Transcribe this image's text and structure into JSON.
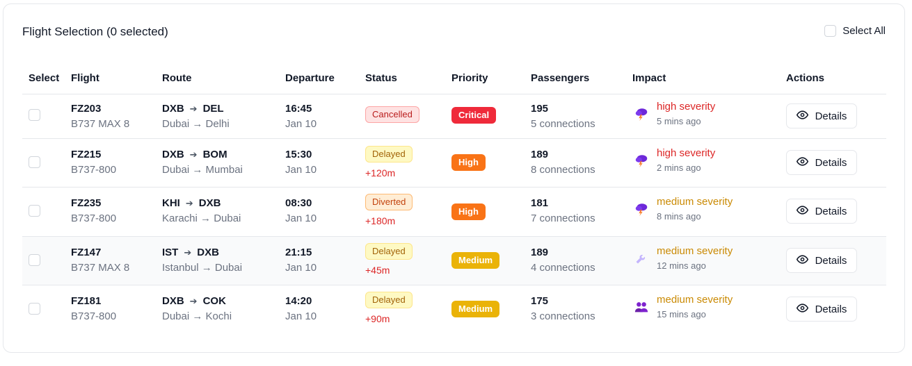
{
  "header": {
    "title": "Flight Selection (0 selected)",
    "select_all_label": "Select All"
  },
  "columns": [
    "Select",
    "Flight",
    "Route",
    "Departure",
    "Status",
    "Priority",
    "Passengers",
    "Impact",
    "Actions"
  ],
  "details_label": "Details",
  "rows": [
    {
      "flight": "FZ203",
      "aircraft": "B737 MAX 8",
      "from": "DXB",
      "to": "DEL",
      "route_text": "Dubai → Delhi",
      "time": "16:45",
      "date": "Jan 10",
      "status": "Cancelled",
      "delay": "",
      "priority": "Critical",
      "passengers": "195",
      "connections": "5 connections",
      "impact_icon": "storm-icon",
      "severity": "high severity",
      "ago": "5 mins ago"
    },
    {
      "flight": "FZ215",
      "aircraft": "B737-800",
      "from": "DXB",
      "to": "BOM",
      "route_text": "Dubai → Mumbai",
      "time": "15:30",
      "date": "Jan 10",
      "status": "Delayed",
      "delay": "+120m",
      "priority": "High",
      "passengers": "189",
      "connections": "8 connections",
      "impact_icon": "storm-icon",
      "severity": "high severity",
      "ago": "2 mins ago"
    },
    {
      "flight": "FZ235",
      "aircraft": "B737-800",
      "from": "KHI",
      "to": "DXB",
      "route_text": "Karachi → Dubai",
      "time": "08:30",
      "date": "Jan 10",
      "status": "Diverted",
      "delay": "+180m",
      "priority": "High",
      "passengers": "181",
      "connections": "7 connections",
      "impact_icon": "storm-icon",
      "severity": "medium severity",
      "ago": "8 mins ago"
    },
    {
      "flight": "FZ147",
      "aircraft": "B737 MAX 8",
      "from": "IST",
      "to": "DXB",
      "route_text": "Istanbul → Dubai",
      "time": "21:15",
      "date": "Jan 10",
      "status": "Delayed",
      "delay": "+45m",
      "priority": "Medium",
      "passengers": "189",
      "connections": "4 connections",
      "impact_icon": "wrench-icon",
      "severity": "medium severity",
      "ago": "12 mins ago"
    },
    {
      "flight": "FZ181",
      "aircraft": "B737-800",
      "from": "DXB",
      "to": "COK",
      "route_text": "Dubai → Kochi",
      "time": "14:20",
      "date": "Jan 10",
      "status": "Delayed",
      "delay": "+90m",
      "priority": "Medium",
      "passengers": "175",
      "connections": "3 connections",
      "impact_icon": "crew-icon",
      "severity": "medium severity",
      "ago": "15 mins ago"
    }
  ],
  "colors": {
    "critical": "#ef2a3a",
    "high": "#f97316",
    "medium": "#eab308",
    "severity_high": "#dc2626",
    "severity_medium": "#ca8a04",
    "delay": "#dc2626"
  }
}
